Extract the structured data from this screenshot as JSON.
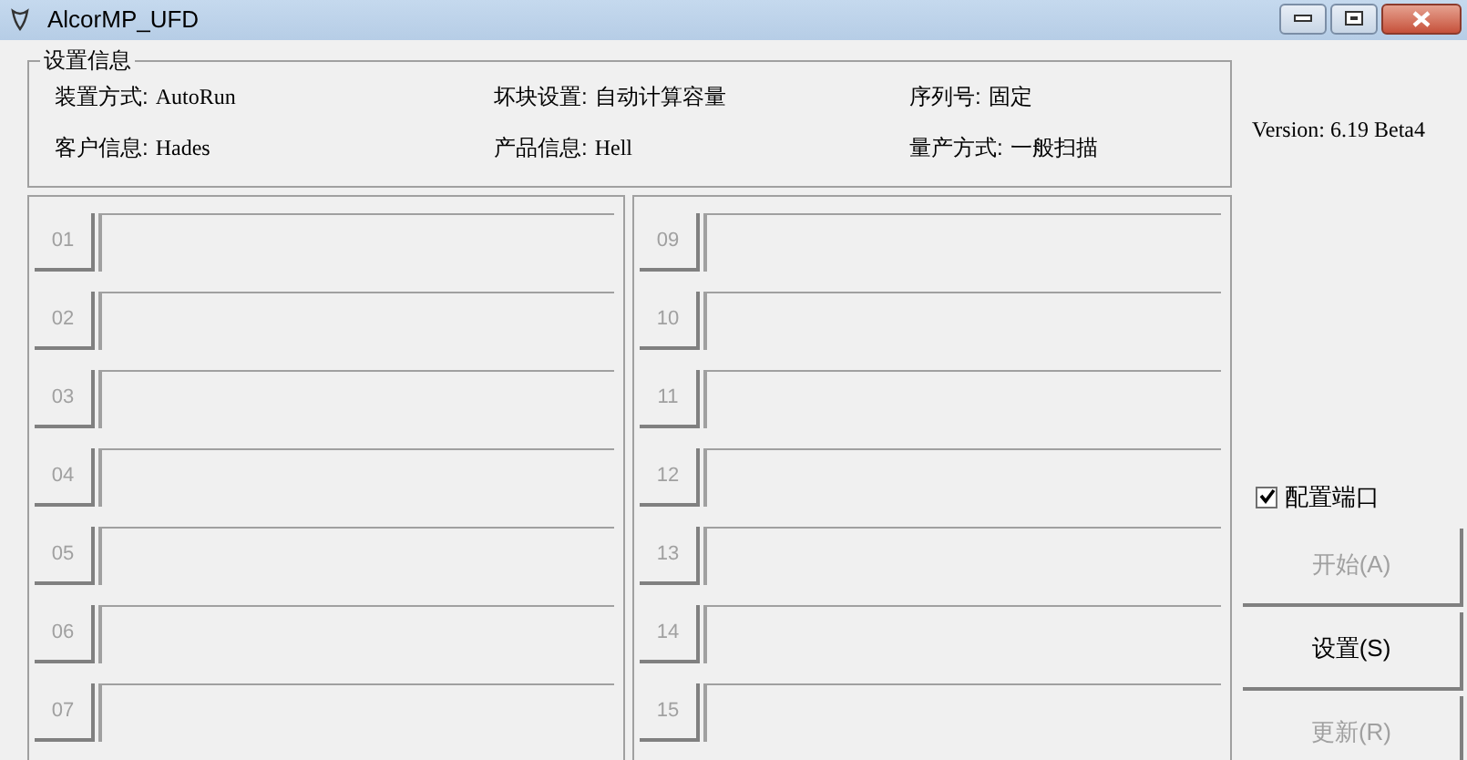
{
  "window": {
    "title": "AlcorMP_UFD"
  },
  "settings_group": {
    "title": "设置信息",
    "fields": [
      {
        "label": "装置方式:",
        "value": "AutoRun"
      },
      {
        "label": "坏块设置:",
        "value": "自动计算容量"
      },
      {
        "label": "序列号:",
        "value": "固定"
      },
      {
        "label": "客户信息:",
        "value": "Hades"
      },
      {
        "label": "产品信息:",
        "value": "Hell"
      },
      {
        "label": "量产方式:",
        "value": "一般扫描"
      }
    ]
  },
  "port_panels": [
    {
      "ports": [
        {
          "label": "01",
          "disabled": true
        },
        {
          "label": "02",
          "disabled": true
        },
        {
          "label": "03",
          "disabled": true
        },
        {
          "label": "04",
          "disabled": true
        },
        {
          "label": "05",
          "disabled": true
        },
        {
          "label": "06",
          "disabled": true
        },
        {
          "label": "07",
          "disabled": true
        }
      ]
    },
    {
      "ports": [
        {
          "label": "09",
          "disabled": true
        },
        {
          "label": "10",
          "disabled": true
        },
        {
          "label": "11",
          "disabled": true
        },
        {
          "label": "12",
          "disabled": true
        },
        {
          "label": "13",
          "disabled": true
        },
        {
          "label": "14",
          "disabled": true
        },
        {
          "label": "15",
          "disabled": true
        }
      ]
    }
  ],
  "version": "Version: 6.19 Beta4",
  "configure_ports": {
    "label": "配置端口",
    "checked": true
  },
  "buttons": [
    {
      "label": "开始(A)",
      "disabled": true
    },
    {
      "label": "设置(S)",
      "disabled": false
    },
    {
      "label": "更新(R)",
      "disabled": true
    }
  ]
}
